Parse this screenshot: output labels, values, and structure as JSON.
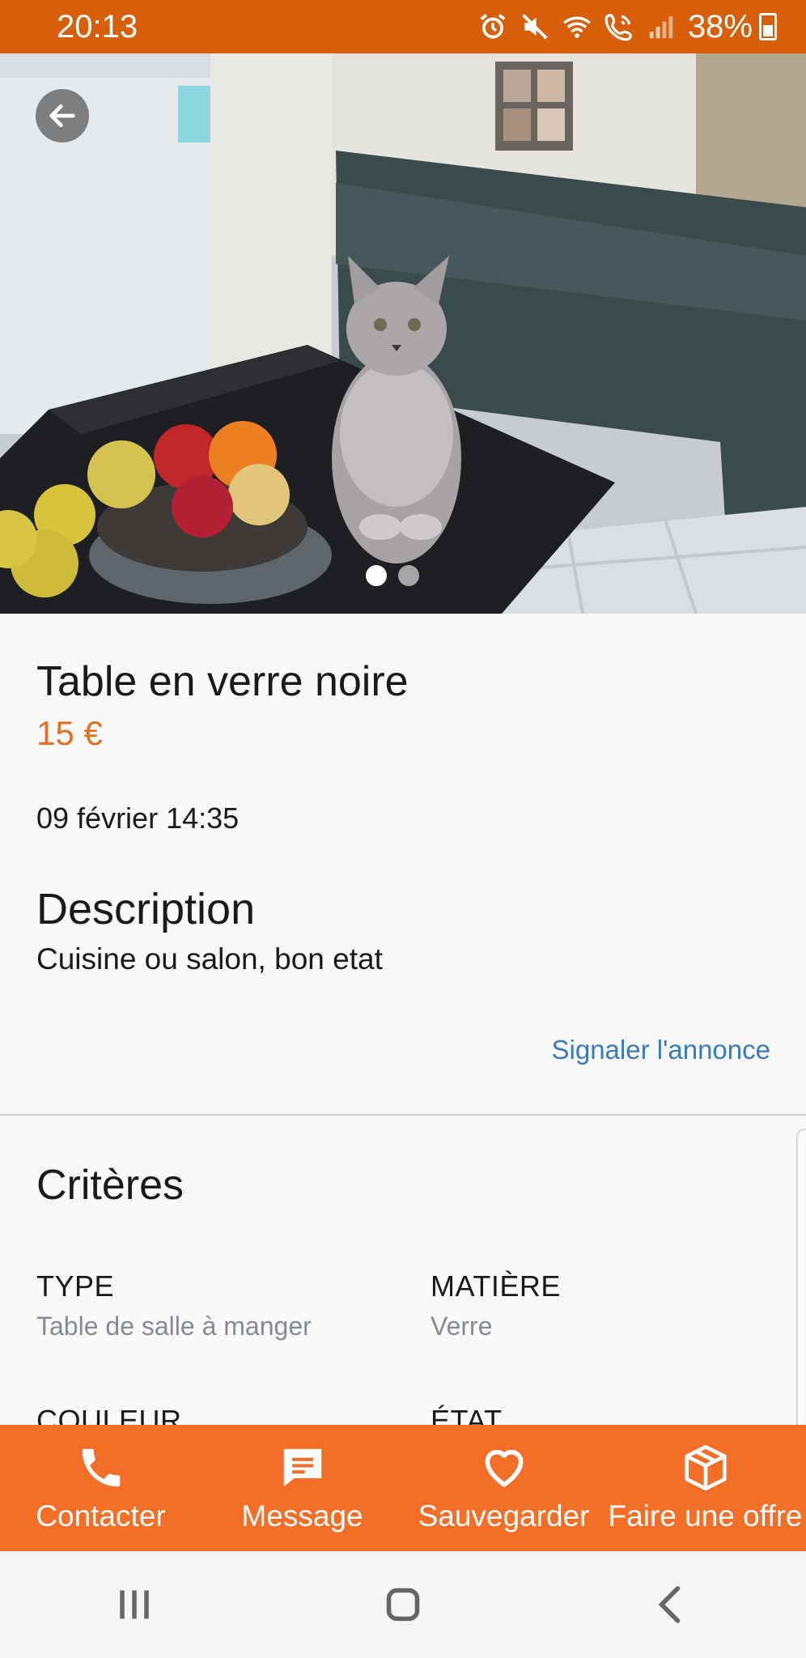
{
  "status_bar": {
    "time": "20:13",
    "battery": "38%",
    "icons": [
      "alarm-icon",
      "mute-icon",
      "wifi-icon",
      "wifi-call-icon",
      "signal-icon",
      "battery-icon"
    ]
  },
  "gallery": {
    "image_count": 2,
    "active_index": 0
  },
  "listing": {
    "title": "Table en verre noire",
    "price": "15 €",
    "date": "09 février 14:35",
    "description_heading": "Description",
    "description_text": "Cuisine ou salon, bon etat",
    "report_link": "Signaler l'annonce"
  },
  "criteria": {
    "heading": "Critères",
    "items": [
      {
        "label": "TYPE",
        "value": "Table de salle à manger"
      },
      {
        "label": "MATIÈRE",
        "value": "Verre"
      },
      {
        "label": "COULEUR",
        "value": ""
      },
      {
        "label": "ÉTAT",
        "value": ""
      }
    ]
  },
  "actions": [
    {
      "label": "Contacter",
      "icon": "phone-icon"
    },
    {
      "label": "Message",
      "icon": "message-icon"
    },
    {
      "label": "Sauvegarder",
      "icon": "heart-icon"
    },
    {
      "label": "Faire une offre",
      "icon": "box-icon"
    }
  ],
  "colors": {
    "status_bar": "#d75f0a",
    "accent": "#f36e27",
    "price": "#e27127",
    "link": "#3a7bbf"
  }
}
